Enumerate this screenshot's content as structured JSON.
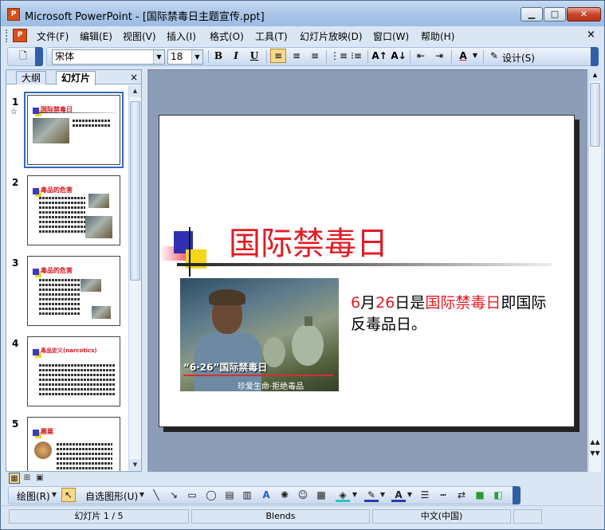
{
  "window": {
    "title": "Microsoft PowerPoint - [国际禁毒日主题宣传.ppt]",
    "minimize": "▭",
    "maximize": "□",
    "close": "✕"
  },
  "menu": {
    "items": [
      "文件(F)",
      "编辑(E)",
      "视图(V)",
      "插入(I)",
      "格式(O)",
      "工具(T)",
      "幻灯片放映(D)",
      "窗口(W)",
      "帮助(H)"
    ],
    "close": "×"
  },
  "toolbar": {
    "font_name": "宋体",
    "font_size": "18",
    "bold": "B",
    "italic": "I",
    "underline": "U",
    "design_label": "设计(S)",
    "font_color": "A"
  },
  "outline_pane": {
    "tab_outline": "大纲",
    "tab_slides": "幻灯片",
    "close": "×",
    "slides": [
      {
        "number": "1",
        "title": "国际禁毒日"
      },
      {
        "number": "2",
        "title": "毒品的危害"
      },
      {
        "number": "3",
        "title": "毒品的危害"
      },
      {
        "number": "4",
        "title": "毒品定义(narcotics)"
      },
      {
        "number": "5",
        "title": "罂粟"
      }
    ]
  },
  "slide": {
    "title": "国际禁毒日",
    "photo_caption": "“6·26”国际禁毒日",
    "photo_subcaption": "珍爱生命·拒绝毒品",
    "text_part1_red": "6",
    "text_part2": "月",
    "text_part3_red": "26",
    "text_part4": "日是",
    "text_part5_red": "国际禁毒日",
    "text_part6": "即国际反毒品日。"
  },
  "drawing_toolbar": {
    "draw_label": "绘图(R)",
    "autoshapes_label": "自选图形(U)"
  },
  "status": {
    "slide_position": "幻灯片 1 / 5",
    "design_template": "Blends",
    "language": "中文(中国)"
  },
  "colors": {
    "title_red": "#e31b23",
    "titlebar_blue": "#a9c5e6",
    "workspace": "#8d9cb7"
  }
}
